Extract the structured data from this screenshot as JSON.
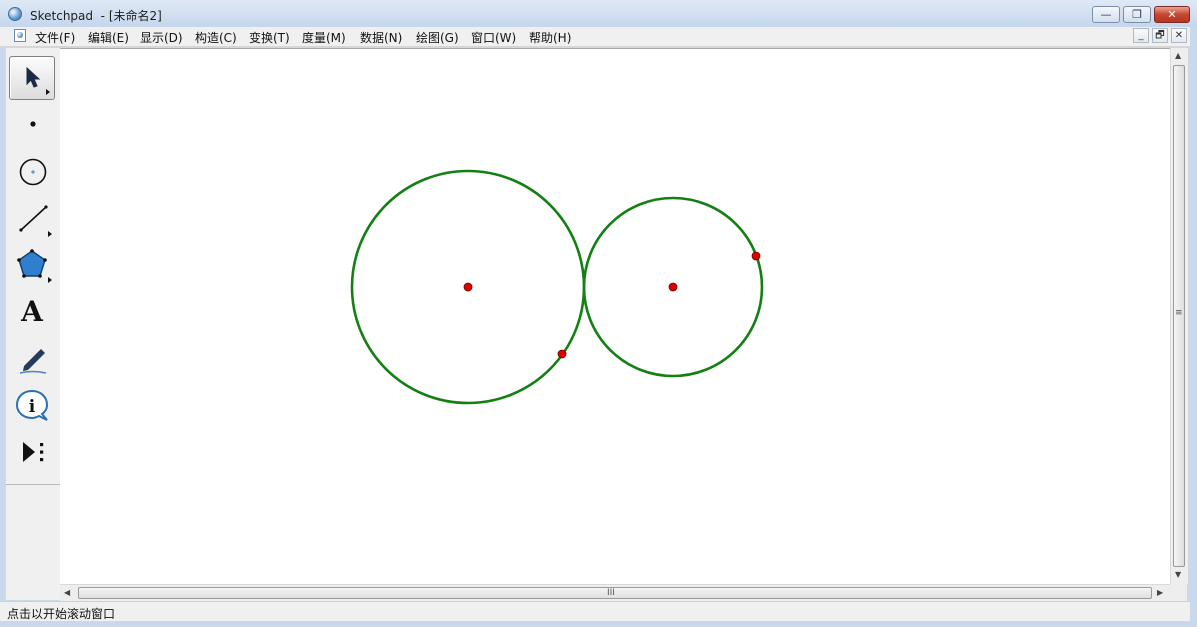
{
  "window": {
    "app_name": "Sketchpad",
    "document_title": "- [未命名2]",
    "buttons": {
      "minimize": "—",
      "restore": "❐",
      "close": "✕"
    }
  },
  "menu": {
    "items": [
      "文件(F)",
      "编辑(E)",
      "显示(D)",
      "构造(C)",
      "变换(T)",
      "度量(M)",
      "数据(N)",
      "绘图(G)",
      "窗口(W)",
      "帮助(H)"
    ],
    "mdi_buttons": {
      "minimize": "_",
      "restore": "🗗",
      "close": "✕"
    }
  },
  "toolbox": {
    "tools": [
      {
        "name": "selection-arrow-tool",
        "selected": true
      },
      {
        "name": "point-tool",
        "selected": false
      },
      {
        "name": "compass-tool",
        "selected": false
      },
      {
        "name": "straightedge-tool",
        "selected": false
      },
      {
        "name": "polygon-tool",
        "selected": false
      },
      {
        "name": "text-tool",
        "selected": false,
        "glyph": "A"
      },
      {
        "name": "marker-tool",
        "selected": false
      },
      {
        "name": "information-tool",
        "selected": false,
        "glyph": "i"
      },
      {
        "name": "custom-tool",
        "selected": false
      }
    ]
  },
  "colors": {
    "circle_stroke": "#128012",
    "point_fill": "#e00000",
    "point_stroke": "#700000"
  },
  "scrollbar": {
    "grip_vertical": "≡",
    "grip_horizontal": "III"
  },
  "status": {
    "text": "点击以开始滚动窗口"
  }
}
